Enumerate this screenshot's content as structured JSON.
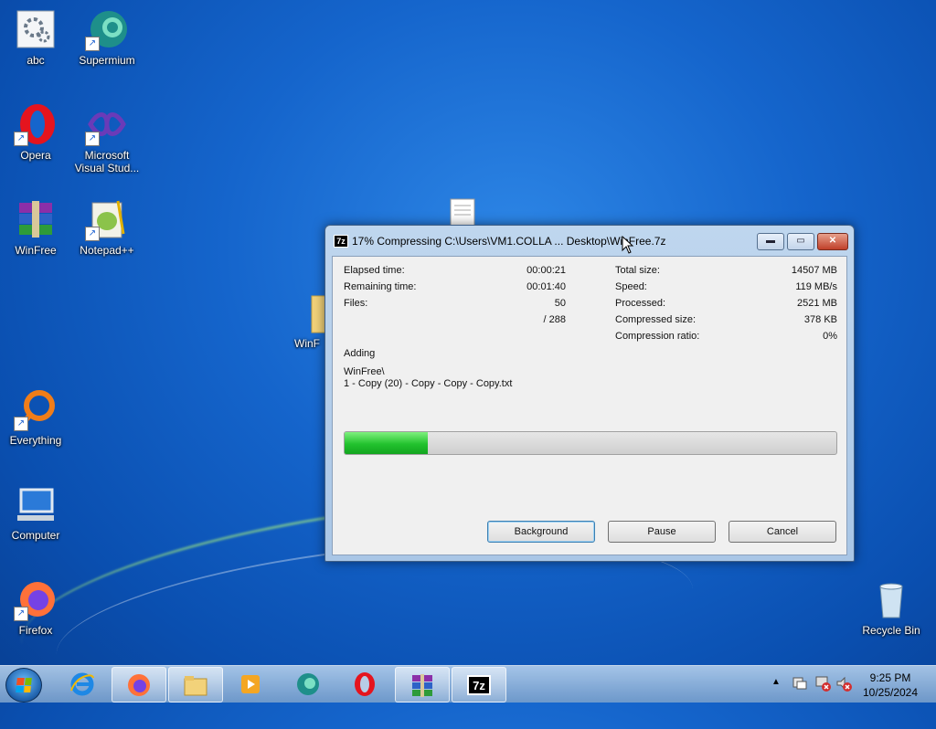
{
  "desktop": {
    "icons": [
      {
        "label": "abc"
      },
      {
        "label": "Supermium"
      },
      {
        "label": "Opera"
      },
      {
        "label": "Microsoft Visual Stud..."
      },
      {
        "label": "WinFree"
      },
      {
        "label": "Notepad++"
      },
      {
        "label": "Everything"
      },
      {
        "label": "Computer"
      },
      {
        "label": "Firefox"
      },
      {
        "label": "Recycle Bin"
      },
      {
        "label": "WinF"
      }
    ]
  },
  "dialog": {
    "app_icon": "7z",
    "title": "17% Compressing C:\\Users\\VM1.COLLA ... Desktop\\WinFree.7z",
    "minimize_glyph": "▬",
    "maximize_glyph": "▭",
    "close_glyph": "✕",
    "elapsed_label": "Elapsed time:",
    "elapsed_value": "00:00:21",
    "remaining_label": "Remaining time:",
    "remaining_value": "00:01:40",
    "files_label": "Files:",
    "files_value": "50",
    "files_total": "/ 288",
    "total_size_label": "Total size:",
    "total_size_value": "14507 MB",
    "speed_label": "Speed:",
    "speed_value": "119 MB/s",
    "processed_label": "Processed:",
    "processed_value": "2521 MB",
    "compressed_label": "Compressed size:",
    "compressed_value": "378 KB",
    "ratio_label": "Compression ratio:",
    "ratio_value": "0%",
    "action": "Adding",
    "current_folder": "WinFree\\",
    "current_file": "1 - Copy (20) - Copy - Copy - Copy.txt",
    "progress_percent": 17,
    "background_button": "Background",
    "pause_button": "Pause",
    "cancel_button": "Cancel"
  },
  "taskbar": {
    "items": [
      "internet-explorer",
      "firefox",
      "file-explorer",
      "media-player",
      "supermium",
      "opera",
      "winrar",
      "7zip"
    ],
    "time": "9:25 PM",
    "date": "10/25/2024",
    "tray_arrow": "▲"
  }
}
